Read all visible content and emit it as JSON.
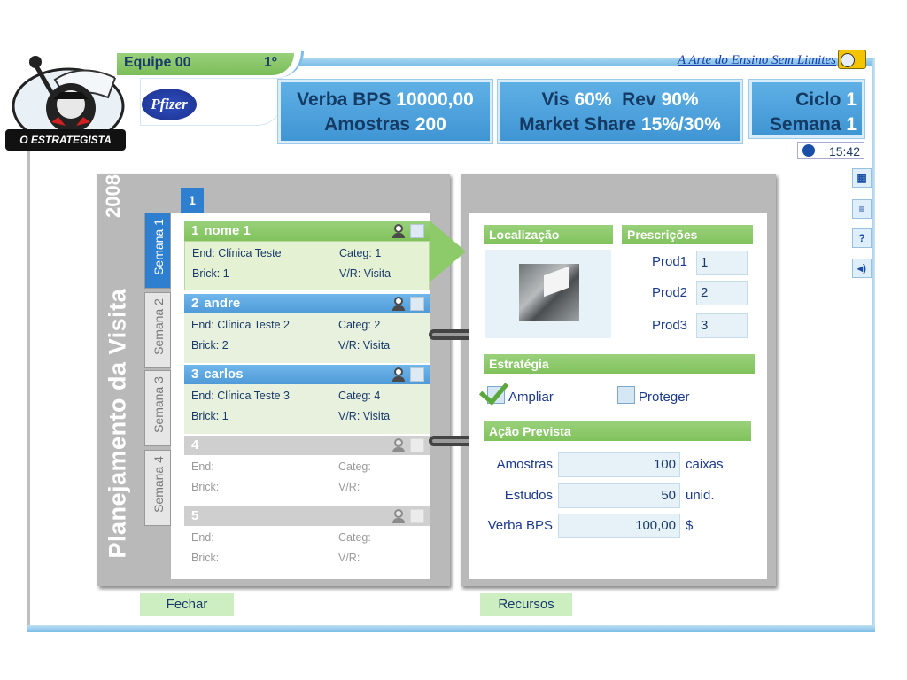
{
  "header": {
    "team_name": "Equipe 00",
    "team_rank": "1º",
    "tagline": "A Arte do Ensino Sem Limites",
    "brand": "Pfizer",
    "logo_label": "O ESTRATEGISTA"
  },
  "stats": {
    "budget_label": "Verba BPS",
    "budget_value": "10000,00",
    "samples_label": "Amostras",
    "samples_value": "200",
    "vis_label": "Vis",
    "vis_value": "60%",
    "rev_label": "Rev",
    "rev_value": "90%",
    "share_label": "Market Share",
    "share_value": "15%/30%",
    "cycle_label": "Ciclo",
    "cycle_value": "1",
    "week_label": "Semana",
    "week_value": "1",
    "clock": "15:42"
  },
  "tools": [
    "calculator-icon",
    "notes-icon",
    "help-icon",
    "sound-icon"
  ],
  "planner": {
    "title": "Planejamento da Visita",
    "year": "2008",
    "cycle_tab": "1",
    "weeks": [
      "Semana 1",
      "Semana 2",
      "Semana 3",
      "Semana 4"
    ],
    "visits": [
      {
        "num": "1",
        "name": "nome 1",
        "end_label": "End:",
        "end": "Clínica Teste",
        "categ_label": "Categ:",
        "categ": "1",
        "brick_label": "Brick:",
        "brick": "1",
        "vr_label": "V/R:",
        "vr": "Visita"
      },
      {
        "num": "2",
        "name": "andre",
        "end_label": "End:",
        "end": "Clínica Teste 2",
        "categ_label": "Categ:",
        "categ": "2",
        "brick_label": "Brick:",
        "brick": "2",
        "vr_label": "V/R:",
        "vr": "Visita"
      },
      {
        "num": "3",
        "name": "carlos",
        "end_label": "End:",
        "end": "Clínica Teste 3",
        "categ_label": "Categ:",
        "categ": "4",
        "brick_label": "Brick:",
        "brick": "1",
        "vr_label": "V/R:",
        "vr": "Visita"
      },
      {
        "num": "4",
        "name": "",
        "end_label": "End:",
        "end": "",
        "categ_label": "Categ:",
        "categ": "",
        "brick_label": "Brick:",
        "brick": "",
        "vr_label": "V/R:",
        "vr": ""
      },
      {
        "num": "5",
        "name": "",
        "end_label": "End:",
        "end": "",
        "categ_label": "Categ:",
        "categ": "",
        "brick_label": "Brick:",
        "brick": "",
        "vr_label": "V/R:",
        "vr": ""
      }
    ]
  },
  "detail": {
    "location_title": "Localização",
    "prescriptions_title": "Prescrições",
    "prescriptions": [
      {
        "label": "Prod1",
        "value": "1"
      },
      {
        "label": "Prod2",
        "value": "2"
      },
      {
        "label": "Prod3",
        "value": "3"
      }
    ],
    "strategy_title": "Estratégia",
    "strategy_options": [
      {
        "label": "Ampliar",
        "checked": true
      },
      {
        "label": "Proteger",
        "checked": false
      }
    ],
    "action_title": "Ação Prevista",
    "actions": [
      {
        "label": "Amostras",
        "value": "100",
        "unit": "caixas"
      },
      {
        "label": "Estudos",
        "value": "50",
        "unit": "unid."
      },
      {
        "label": "Verba BPS",
        "value": "100,00",
        "unit": "$"
      }
    ]
  },
  "buttons": {
    "close": "Fechar",
    "resources": "Recursos"
  }
}
